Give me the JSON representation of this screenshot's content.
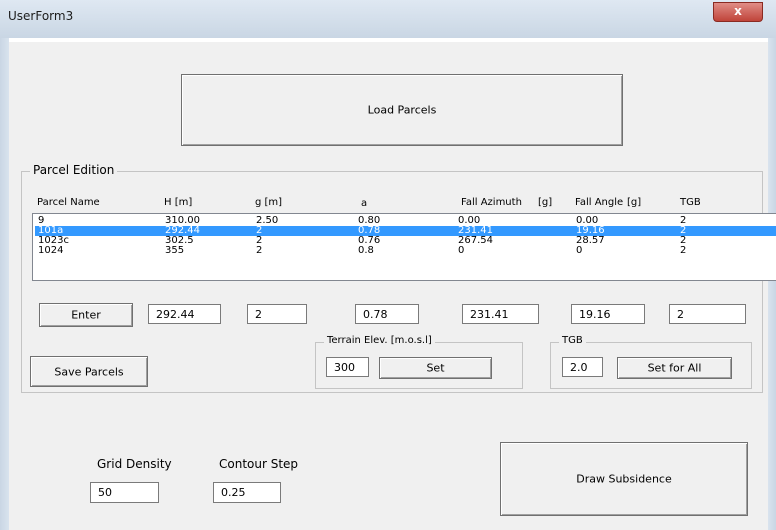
{
  "window": {
    "title": "UserForm3",
    "close_label": "x"
  },
  "load_button": "Load Parcels",
  "parcel_group": {
    "label": "Parcel Edition",
    "columns": [
      "Parcel Name",
      "H [m]",
      "g [m]",
      "a",
      "Fall Azimuth",
      "[g]",
      "Fall Angle",
      "[g]",
      "TGB"
    ],
    "rows": [
      {
        "name": "9",
        "h": "310.00",
        "g": "2.50",
        "a": "0.80",
        "azimuth": "0.00",
        "angle": "0.00",
        "tgb": "2"
      },
      {
        "name": "101a",
        "h": "292.44",
        "g": "2",
        "a": "0.78",
        "azimuth": "231.41",
        "angle": "19.16",
        "tgb": "2"
      },
      {
        "name": "1023c",
        "h": "302.5",
        "g": "2",
        "a": "0.76",
        "azimuth": "267.54",
        "angle": "28.57",
        "tgb": "2"
      },
      {
        "name": "1024",
        "h": "355",
        "g": "2",
        "a": "0.8",
        "azimuth": "0",
        "angle": "0",
        "tgb": "2"
      }
    ],
    "selected_row": 1,
    "enter_button": "Enter",
    "edit_fields": {
      "h": "292.44",
      "g": "2",
      "a": "0.78",
      "azimuth": "231.41",
      "angle": "19.16",
      "tgb": "2"
    },
    "save_button": "Save Parcels",
    "terrain": {
      "label": "Terrain Elev. [m.o.s.l]",
      "value": "300",
      "set_button": "Set"
    },
    "tgb": {
      "label": "TGB",
      "value": "2.0",
      "set_all_button": "Set for All"
    }
  },
  "grid_density": {
    "label": "Grid Density",
    "value": "50"
  },
  "contour_step": {
    "label": "Contour Step",
    "value": "0.25"
  },
  "draw_button": "Draw Subsidence",
  "colors": {
    "selection": "#3399ff",
    "close_button": "#c0443a"
  }
}
